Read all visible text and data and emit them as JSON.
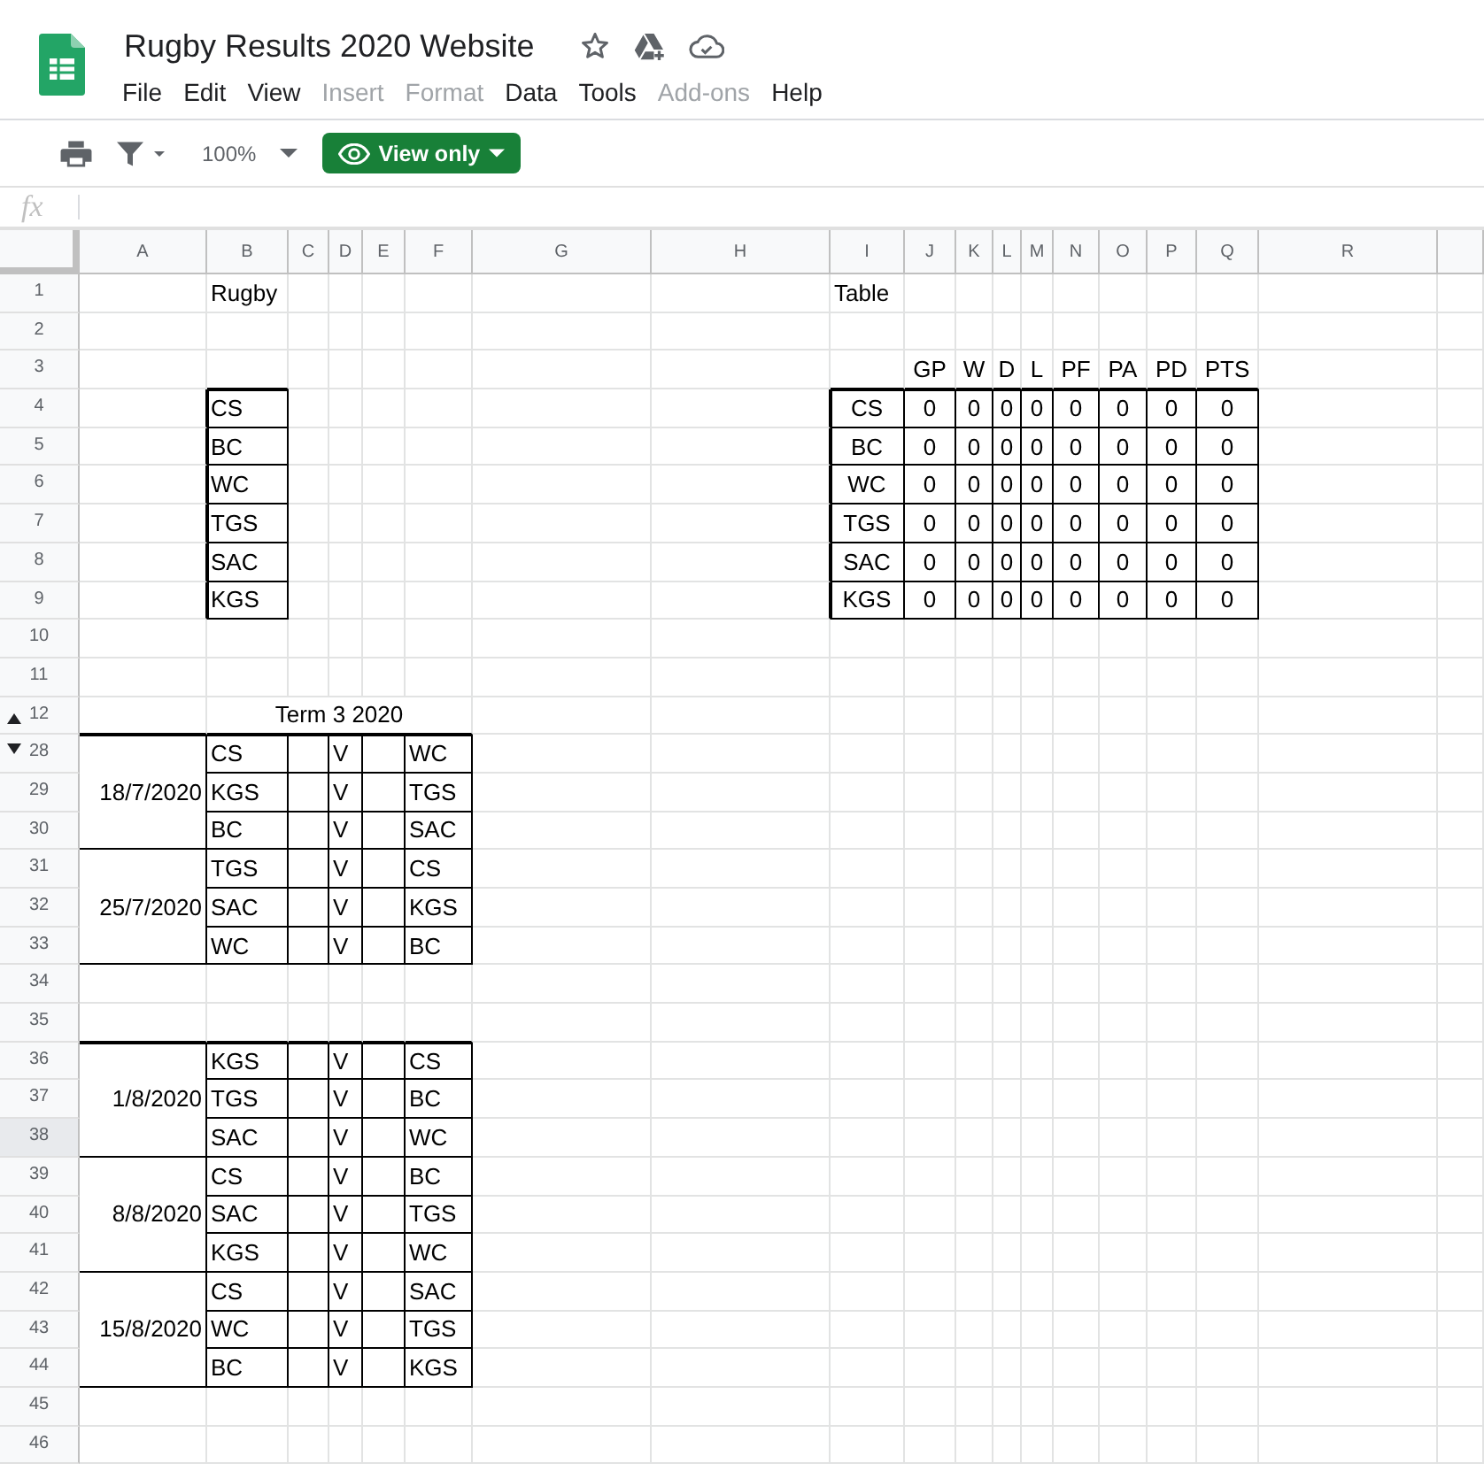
{
  "app": {
    "title": "Rugby Results 2020 Website",
    "menus": [
      {
        "label": "File",
        "disabled": false
      },
      {
        "label": "Edit",
        "disabled": false
      },
      {
        "label": "View",
        "disabled": false
      },
      {
        "label": "Insert",
        "disabled": true
      },
      {
        "label": "Format",
        "disabled": true
      },
      {
        "label": "Data",
        "disabled": false
      },
      {
        "label": "Tools",
        "disabled": false
      },
      {
        "label": "Add-ons",
        "disabled": true
      },
      {
        "label": "Help",
        "disabled": false
      }
    ]
  },
  "toolbar": {
    "zoom": "100%",
    "view_button": "View only"
  },
  "formula_bar": {
    "label": "fx"
  },
  "columns": [
    "A",
    "B",
    "C",
    "D",
    "E",
    "F",
    "G",
    "H",
    "I",
    "J",
    "K",
    "L",
    "M",
    "N",
    "O",
    "P",
    "Q",
    "R"
  ],
  "rows": [
    {
      "label": "1",
      "kind": "plain",
      "selected": false
    },
    {
      "label": "2",
      "kind": "plain",
      "selected": false
    },
    {
      "label": "3",
      "kind": "plain",
      "selected": false
    },
    {
      "label": "4",
      "kind": "plain",
      "selected": false
    },
    {
      "label": "5",
      "kind": "plain",
      "selected": false
    },
    {
      "label": "6",
      "kind": "plain",
      "selected": false
    },
    {
      "label": "7",
      "kind": "plain",
      "selected": false
    },
    {
      "label": "8",
      "kind": "plain",
      "selected": false
    },
    {
      "label": "9",
      "kind": "plain",
      "selected": false
    },
    {
      "label": "10",
      "kind": "plain",
      "selected": false
    },
    {
      "label": "11",
      "kind": "plain",
      "selected": false
    },
    {
      "label": "12",
      "kind": "hidden-below",
      "selected": false
    },
    {
      "label": "28",
      "kind": "hidden-above",
      "selected": false
    },
    {
      "label": "29",
      "kind": "plain",
      "selected": false
    },
    {
      "label": "30",
      "kind": "plain",
      "selected": false
    },
    {
      "label": "31",
      "kind": "plain",
      "selected": false
    },
    {
      "label": "32",
      "kind": "plain",
      "selected": false
    },
    {
      "label": "33",
      "kind": "plain",
      "selected": false
    },
    {
      "label": "34",
      "kind": "plain",
      "selected": false
    },
    {
      "label": "35",
      "kind": "plain",
      "selected": false
    },
    {
      "label": "36",
      "kind": "plain",
      "selected": false
    },
    {
      "label": "37",
      "kind": "plain",
      "selected": false
    },
    {
      "label": "38",
      "kind": "plain",
      "selected": true
    },
    {
      "label": "39",
      "kind": "plain",
      "selected": false
    },
    {
      "label": "40",
      "kind": "plain",
      "selected": false
    },
    {
      "label": "41",
      "kind": "plain",
      "selected": false
    },
    {
      "label": "42",
      "kind": "plain",
      "selected": false
    },
    {
      "label": "43",
      "kind": "plain",
      "selected": false
    },
    {
      "label": "44",
      "kind": "plain",
      "selected": false
    },
    {
      "label": "45",
      "kind": "plain",
      "selected": false
    },
    {
      "label": "46",
      "kind": "plain",
      "selected": false
    }
  ],
  "sheet": {
    "title": "Rugby",
    "teams": [
      "CS",
      "BC",
      "WC",
      "TGS",
      "SAC",
      "KGS"
    ],
    "table_title": "Table",
    "table_headers": [
      "GP",
      "W",
      "D",
      "L",
      "PF",
      "PA",
      "PD",
      "PTS"
    ],
    "standings": [
      {
        "team": "CS",
        "values": [
          "0",
          "0",
          "0",
          "0",
          "0",
          "0",
          "0",
          "0"
        ]
      },
      {
        "team": "BC",
        "values": [
          "0",
          "0",
          "0",
          "0",
          "0",
          "0",
          "0",
          "0"
        ]
      },
      {
        "team": "WC",
        "values": [
          "0",
          "0",
          "0",
          "0",
          "0",
          "0",
          "0",
          "0"
        ]
      },
      {
        "team": "TGS",
        "values": [
          "0",
          "0",
          "0",
          "0",
          "0",
          "0",
          "0",
          "0"
        ]
      },
      {
        "team": "SAC",
        "values": [
          "0",
          "0",
          "0",
          "0",
          "0",
          "0",
          "0",
          "0"
        ]
      },
      {
        "team": "KGS",
        "values": [
          "0",
          "0",
          "0",
          "0",
          "0",
          "0",
          "0",
          "0"
        ]
      }
    ],
    "term_title": "Term 3 2020",
    "fixture_groups": [
      {
        "blocks": [
          {
            "date": "18/7/2020",
            "matches": [
              {
                "home": "CS",
                "vs": "V",
                "away": "WC"
              },
              {
                "home": "KGS",
                "vs": "V",
                "away": "TGS"
              },
              {
                "home": "BC",
                "vs": "V",
                "away": "SAC"
              }
            ]
          },
          {
            "date": "25/7/2020",
            "matches": [
              {
                "home": "TGS",
                "vs": "V",
                "away": "CS"
              },
              {
                "home": "SAC",
                "vs": "V",
                "away": "KGS"
              },
              {
                "home": "WC",
                "vs": "V",
                "away": "BC"
              }
            ]
          }
        ]
      },
      {
        "blocks": [
          {
            "date": "1/8/2020",
            "matches": [
              {
                "home": "KGS",
                "vs": "V",
                "away": "CS"
              },
              {
                "home": "TGS",
                "vs": "V",
                "away": "BC"
              },
              {
                "home": "SAC",
                "vs": "V",
                "away": "WC"
              }
            ]
          },
          {
            "date": "8/8/2020",
            "matches": [
              {
                "home": "CS",
                "vs": "V",
                "away": "BC"
              },
              {
                "home": "SAC",
                "vs": "V",
                "away": "TGS"
              },
              {
                "home": "KGS",
                "vs": "V",
                "away": "WC"
              }
            ]
          },
          {
            "date": "15/8/2020",
            "matches": [
              {
                "home": "CS",
                "vs": "V",
                "away": "SAC"
              },
              {
                "home": "WC",
                "vs": "V",
                "away": "TGS"
              },
              {
                "home": "BC",
                "vs": "V",
                "away": "KGS"
              }
            ]
          }
        ]
      }
    ]
  }
}
